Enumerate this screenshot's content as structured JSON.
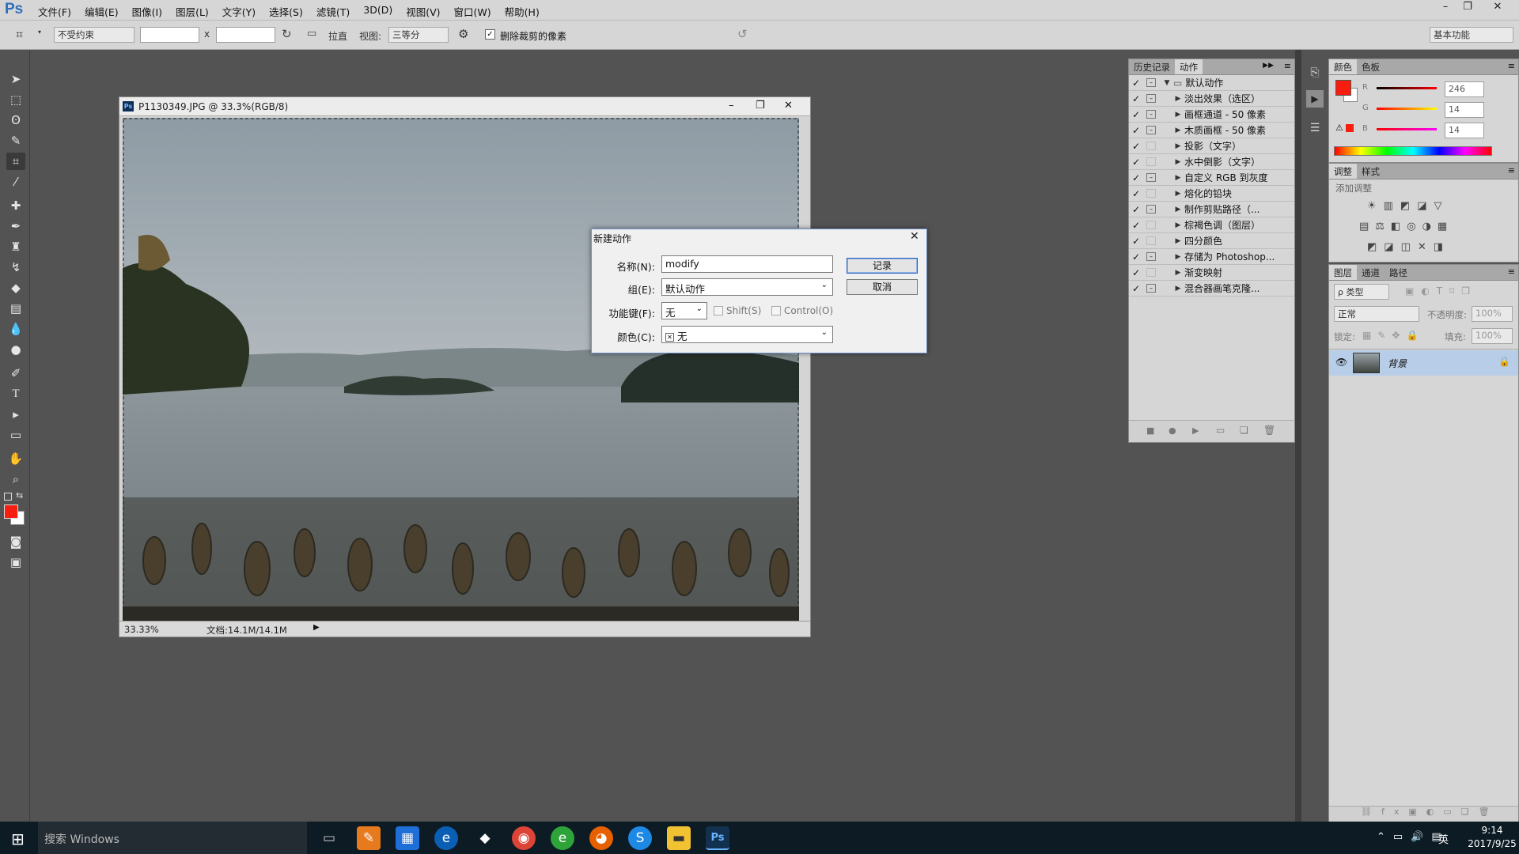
{
  "app": {
    "logo": "Ps"
  },
  "menus": [
    "文件(F)",
    "编辑(E)",
    "图像(I)",
    "图层(L)",
    "文字(Y)",
    "选择(S)",
    "滤镜(T)",
    "3D(D)",
    "视图(V)",
    "窗口(W)",
    "帮助(H)"
  ],
  "window_controls": {
    "minimize": "–",
    "restore": "❐",
    "close": "✕"
  },
  "options": {
    "ratio": "不受约束",
    "times": "x",
    "straighten": "拉直",
    "view_label": "视图:",
    "view_value": "三等分",
    "delete_cropped": "删除裁剪的像素",
    "workspace": "基本功能"
  },
  "document": {
    "title": "P1130349.JPG @ 33.3%(RGB/8)",
    "zoom": "33.33%",
    "doc_info": "文档:14.1M/14.1M"
  },
  "dialog": {
    "title": "新建动作",
    "name_label": "名称(N):",
    "name_value": "modify",
    "group_label": "组(E):",
    "group_value": "默认动作",
    "fkey_label": "功能键(F):",
    "fkey_value": "无",
    "shift": "Shift(S)",
    "control": "Control(O)",
    "color_label": "颜色(C):",
    "color_value": "无",
    "record": "记录",
    "cancel": "取消"
  },
  "actions_panel": {
    "tabs": [
      "历史记录",
      "动作"
    ],
    "set_name": "默认动作",
    "items": [
      {
        "label": "淡出效果（选区）",
        "box": true
      },
      {
        "label": "画框通道 - 50 像素",
        "box": true
      },
      {
        "label": "木质画框 - 50 像素",
        "box": true
      },
      {
        "label": "投影（文字）",
        "box": false
      },
      {
        "label": "水中倒影（文字）",
        "box": false
      },
      {
        "label": "自定义 RGB 到灰度",
        "box": true
      },
      {
        "label": "熔化的铅块",
        "box": false
      },
      {
        "label": "制作剪贴路径（...",
        "box": true
      },
      {
        "label": "棕褐色调（图层）",
        "box": false
      },
      {
        "label": "四分颜色",
        "box": false
      },
      {
        "label": "存储为 Photoshop...",
        "box": true
      },
      {
        "label": "渐变映射",
        "box": false
      },
      {
        "label": "混合器画笔克隆...",
        "box": true
      }
    ]
  },
  "color_panel": {
    "tabs": [
      "颜色",
      "色板"
    ],
    "r": "246",
    "g": "14",
    "b": "14",
    "r_label": "R",
    "g_label": "G",
    "b_label": "B",
    "foreground": "#f61e0e"
  },
  "adjust_panel": {
    "tabs": [
      "调整",
      "样式"
    ],
    "add": "添加调整"
  },
  "layers_panel": {
    "tabs": [
      "图层",
      "通道",
      "路径"
    ],
    "kind": "ρ 类型",
    "blend": "正常",
    "opacity_label": "不透明度:",
    "opacity": "100%",
    "lock_label": "锁定:",
    "fill_label": "填充:",
    "fill": "100%",
    "layer_name": "背景"
  },
  "taskbar": {
    "search": "搜索 Windows",
    "time": "9:14",
    "date": "2017/9/25",
    "ime": "英"
  }
}
